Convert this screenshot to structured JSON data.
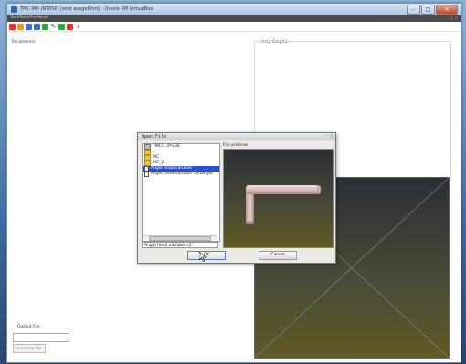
{
  "vbox": {
    "title": "TMC-MO (NT0SP) [wird ausgeführt] - Oracle VM VirtualBox",
    "controls": {
      "minimize": "–",
      "maximize": "□",
      "close": "✕"
    }
  },
  "guest": {
    "title": "TecSTech/ProPanel",
    "toolbar_icons": [
      "close-icon",
      "folder-icon",
      "save-icon",
      "disk-icon",
      "view-icon",
      "pencil-icon",
      "add-icon",
      "target-icon",
      "crosshair-icon"
    ],
    "crosshair_glyph": "+"
  },
  "panels": {
    "parameters_label": "Parameters",
    "help_graphic_label": "Help Graphic",
    "output_file_label": "Output File",
    "generate_button": "Generate File"
  },
  "dialog": {
    "title": "Open File",
    "file_items": [
      {
        "label": "TMC\\...\\P-LSS",
        "icon": "drive",
        "selected": false
      },
      {
        "label": "..",
        "icon": "folder",
        "selected": false
      },
      {
        "label": "PIC",
        "icon": "folder",
        "selected": false
      },
      {
        "label": "PIC_2",
        "icon": "folder",
        "selected": false
      },
      {
        "label": "Angle head variable",
        "icon": "file",
        "selected": true
      },
      {
        "label": "Angle head variable rectangle",
        "icon": "file",
        "selected": false
      }
    ],
    "file_name_value": "Angle head variable.s5",
    "preview_label": "File preview",
    "ok_button": "OK",
    "cancel_button": "Cancel"
  },
  "colors": {
    "selection": "#2a4fd4",
    "preview_top": "#2d2f34",
    "preview_bottom": "#615b22"
  }
}
